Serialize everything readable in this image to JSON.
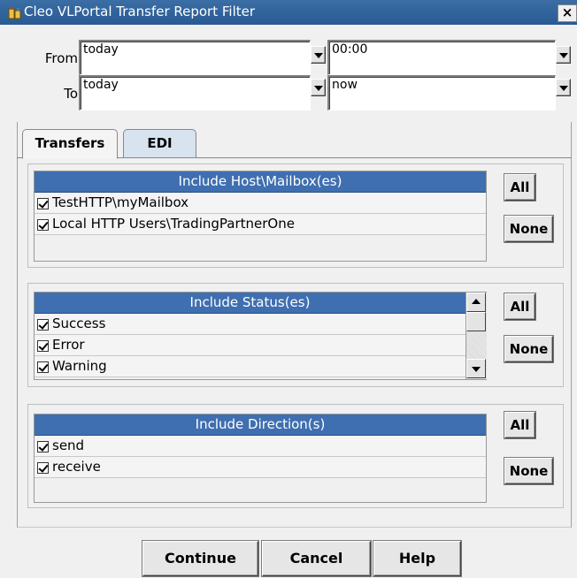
{
  "window": {
    "title": "Cleo VLPortal Transfer Report Filter",
    "close_label": "×"
  },
  "range": {
    "from_label": "From",
    "to_label": "To",
    "from_date": "today",
    "from_time": "00:00",
    "to_date": "today",
    "to_time": "now"
  },
  "tabs": [
    {
      "label": "Transfers",
      "selected": true
    },
    {
      "label": "EDI",
      "selected": false
    }
  ],
  "hosts": {
    "header": "Include Host\\Mailbox(es)",
    "items": [
      {
        "label": "TestHTTP\\myMailbox",
        "checked": true
      },
      {
        "label": "Local HTTP Users\\TradingPartnerOne",
        "checked": true
      }
    ],
    "all_label": "All",
    "none_label": "None"
  },
  "statuses": {
    "header": "Include Status(es)",
    "items": [
      {
        "label": "Success",
        "checked": true
      },
      {
        "label": "Error",
        "checked": true
      },
      {
        "label": "Warning",
        "checked": true
      }
    ],
    "all_label": "All",
    "none_label": "None"
  },
  "directions": {
    "header": "Include Direction(s)",
    "items": [
      {
        "label": "send",
        "checked": true
      },
      {
        "label": "receive",
        "checked": true
      }
    ],
    "all_label": "All",
    "none_label": "None"
  },
  "actions": {
    "continue_label": "Continue",
    "cancel_label": "Cancel",
    "help_label": "Help"
  },
  "colors": {
    "titlebar": "#2e62a0",
    "list_header": "#3f6fb0",
    "tab_edi": "#d7e3ee"
  }
}
